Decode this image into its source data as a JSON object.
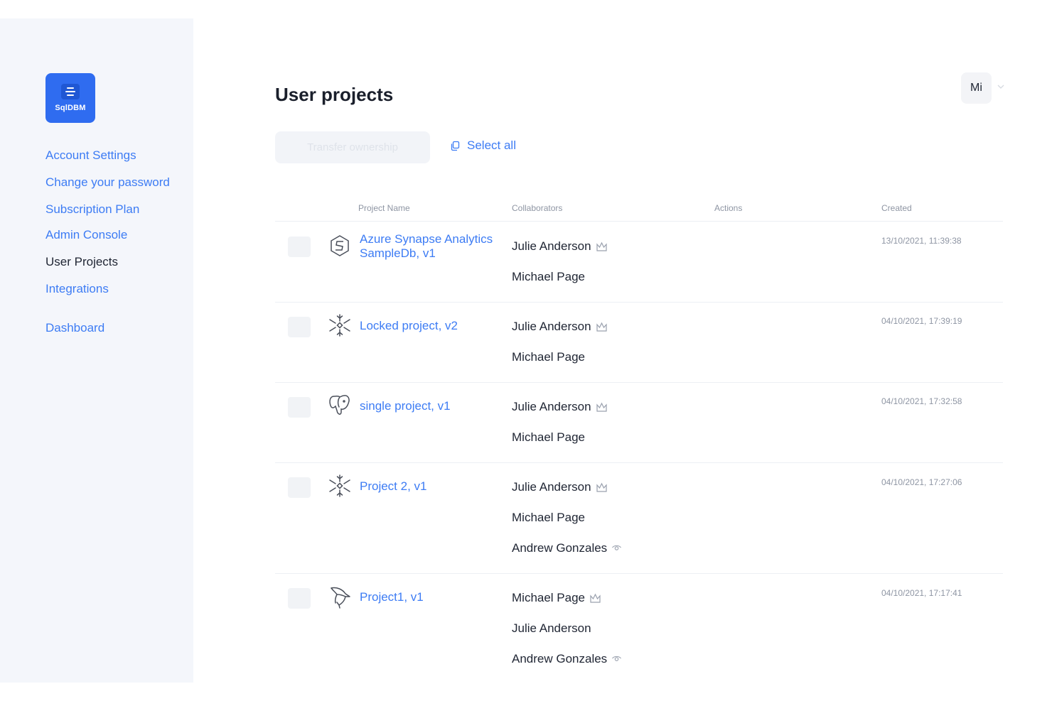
{
  "sidebar": {
    "logo_text": "SqlDBM",
    "items": [
      {
        "label": "Account Settings",
        "active": false
      },
      {
        "label": "Change your password",
        "active": false
      },
      {
        "label": "Subscription Plan",
        "active": false
      },
      {
        "label": "Admin Console",
        "active": false
      },
      {
        "label": "User Projects",
        "active": true
      },
      {
        "label": "Integrations",
        "active": false
      },
      {
        "label": "Dashboard",
        "active": false
      }
    ]
  },
  "header": {
    "title": "User projects",
    "avatar_initials": "Mi"
  },
  "toolbar": {
    "transfer_label": "Transfer ownership",
    "select_all_label": "Select all"
  },
  "table": {
    "columns": [
      "Project Name",
      "Collaborators",
      "Actions",
      "Created"
    ],
    "rows": [
      {
        "icon": "azure-synapse-icon",
        "name": "Azure Synapse Analytics SampleDb, v1",
        "collaborators": [
          {
            "name": "Julie Anderson",
            "role": "owner"
          },
          {
            "name": "Michael Page",
            "role": ""
          }
        ],
        "created": "13/10/2021, 11:39:38"
      },
      {
        "icon": "snowflake-icon",
        "name": "Locked project, v2",
        "collaborators": [
          {
            "name": "Julie Anderson",
            "role": "owner"
          },
          {
            "name": "Michael Page",
            "role": ""
          }
        ],
        "created": "04/10/2021, 17:39:19"
      },
      {
        "icon": "postgresql-icon",
        "name": "single project, v1",
        "collaborators": [
          {
            "name": "Julie Anderson",
            "role": "owner"
          },
          {
            "name": "Michael Page",
            "role": ""
          }
        ],
        "created": "04/10/2021, 17:32:58"
      },
      {
        "icon": "snowflake-icon",
        "name": "Project 2, v1",
        "collaborators": [
          {
            "name": "Julie Anderson",
            "role": "owner"
          },
          {
            "name": "Michael Page",
            "role": ""
          },
          {
            "name": "Andrew Gonzales",
            "role": "viewer"
          }
        ],
        "created": "04/10/2021, 17:27:06"
      },
      {
        "icon": "mysql-icon",
        "name": "Project1, v1",
        "collaborators": [
          {
            "name": "Michael Page",
            "role": "owner"
          },
          {
            "name": "Julie Anderson",
            "role": ""
          },
          {
            "name": "Andrew Gonzales",
            "role": "viewer"
          }
        ],
        "created": "04/10/2021, 17:17:41"
      }
    ]
  },
  "colors": {
    "accent": "#3d7cf4",
    "logo_bg": "#2f6cf0",
    "sidebar_bg": "#f4f6fb",
    "text": "#1f2533",
    "muted": "#8e95a3"
  }
}
